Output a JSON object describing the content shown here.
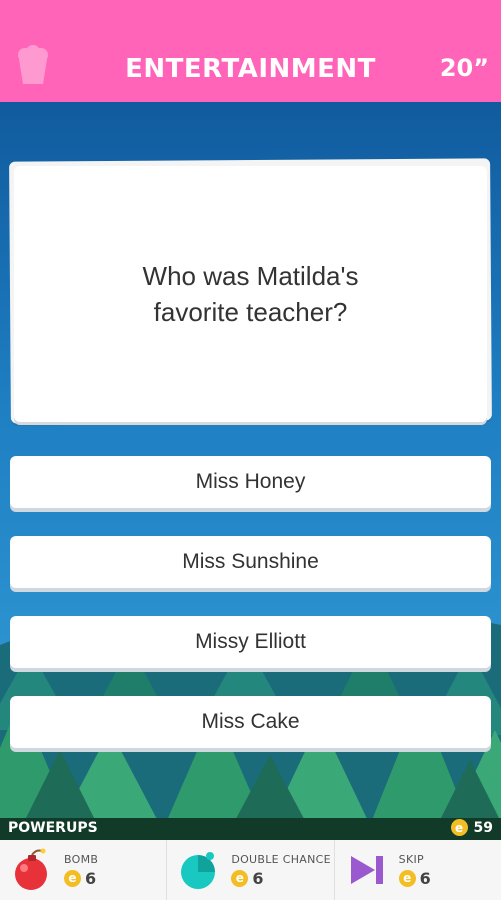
{
  "header": {
    "category": "ENTERTAINMENT",
    "timer": "20”"
  },
  "question": {
    "text": "Who was Matilda's favorite teacher?"
  },
  "answers": [
    "Miss Honey",
    "Miss Sunshine",
    "Missy Elliott",
    "Miss Cake"
  ],
  "powerups_bar": {
    "label": "POWERUPS",
    "coins": "59",
    "coin_symbol": "e"
  },
  "powerups": [
    {
      "name": "BOMB",
      "cost": "6",
      "icon": "bomb-icon"
    },
    {
      "name": "DOUBLE CHANCE",
      "cost": "6",
      "icon": "double-chance-icon"
    },
    {
      "name": "SKIP",
      "cost": "6",
      "icon": "skip-icon"
    }
  ],
  "colors": {
    "header": "#ff64b8",
    "coin": "#f3be24",
    "bomb": "#e8323a",
    "double_chance": "#19c8c0",
    "skip": "#9b59d0"
  }
}
